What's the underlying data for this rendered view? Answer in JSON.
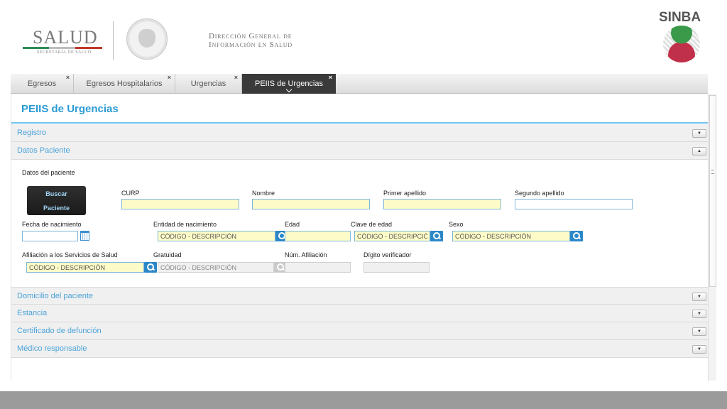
{
  "header": {
    "logo_word": "SALUD",
    "logo_subtitle": "SECRETARÍA DE SALUD",
    "dg_line1": "Dirección General de",
    "dg_line2": "Información en Salud",
    "sinba": "SINBA"
  },
  "tabs": [
    {
      "label": "Egresos",
      "active": false
    },
    {
      "label": "Egresos Hospitalarios",
      "active": false
    },
    {
      "label": "Urgencias",
      "active": false
    },
    {
      "label": "PEIIS de Urgencias",
      "active": true
    }
  ],
  "tab_close_glyph": "×",
  "page_title": "PEIIS de Urgencias",
  "sections": {
    "registro": "Registro",
    "datos_paciente": "Datos Paciente",
    "domicilio": "Domicilio del paciente",
    "estancia": "Estancia",
    "certificado": "Certificado de defunción",
    "medico": "Médico responsable"
  },
  "panel_title": "Datos del paciente",
  "buscar": {
    "line1": "Buscar",
    "line2": "Paciente"
  },
  "fields": {
    "curp": {
      "label": "CURP",
      "value": ""
    },
    "nombre": {
      "label": "Nombre",
      "value": ""
    },
    "primer_apellido": {
      "label": "Primer apellido",
      "value": ""
    },
    "segundo_apellido": {
      "label": "Segundo apellido",
      "value": ""
    },
    "fecha_nacimiento": {
      "label": "Fecha de nacimiento",
      "value": ""
    },
    "entidad_nacimiento": {
      "label": "Entidad de nacimiento",
      "placeholder": "CÓDIGO - DESCRIPCIÓN"
    },
    "edad": {
      "label": "Edad",
      "value": ""
    },
    "clave_edad": {
      "label": "Clave de edad",
      "placeholder": "CÓDIGO - DESCRIPCIÓN"
    },
    "sexo": {
      "label": "Sexo",
      "placeholder": "CÓDIGO - DESCRIPCIÓN"
    },
    "afiliacion": {
      "label": "Afiliación a los Servicios de Salud",
      "placeholder": "CÓDIGO - DESCRIPCIÓN"
    },
    "gratuidad": {
      "label": "Gratuidad",
      "placeholder": "CÓDIGO - DESCRIPCIÓN"
    },
    "num_afiliacion": {
      "label": "Núm. Afiliación",
      "value": ""
    },
    "digito_verificador": {
      "label": "Dígito verificador",
      "value": ""
    }
  },
  "icons": {
    "accordion_collapsed": "chevron-down-icon",
    "accordion_expanded": "chevron-up-icon",
    "lookup": "search-icon",
    "date": "calendar-icon"
  },
  "accordion_glyph_down": "▼",
  "accordion_glyph_up": "▲",
  "colors": {
    "accent": "#2a9bd6",
    "section_text": "#4ba3d9",
    "required_field": "#fdfcc8",
    "lookup_button": "#2b87c8",
    "active_tab": "#3a3a3a"
  }
}
